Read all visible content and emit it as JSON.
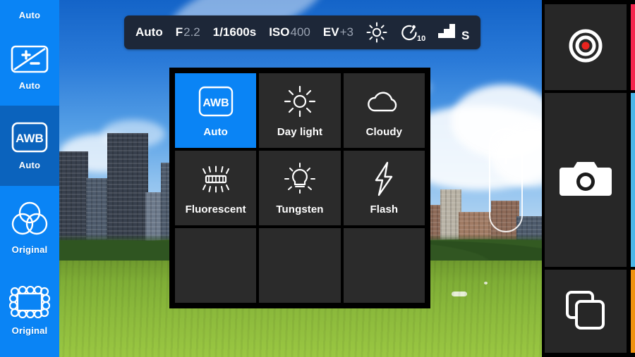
{
  "app": {
    "name": "camera-app",
    "screen": "white-balance-picker"
  },
  "sidebar": {
    "background_color": "#0a84f5",
    "active_color": "#0b63bd",
    "items": [
      {
        "id": "partial-top",
        "icon": "none",
        "label": "Auto",
        "active": false,
        "partial": true
      },
      {
        "id": "exposure-compensation",
        "icon": "plus-minus-icon",
        "label": "Auto",
        "active": false
      },
      {
        "id": "white-balance",
        "icon": "awb-icon",
        "label": "Auto",
        "active": true
      },
      {
        "id": "color-filter",
        "icon": "color-circles-icon",
        "label": "Original",
        "active": false
      },
      {
        "id": "frame",
        "icon": "scalloped-frame-icon",
        "label": "Original",
        "active": false
      }
    ]
  },
  "toolbar": {
    "background_color": "#1d2738",
    "items": [
      {
        "id": "mode",
        "name": "Auto",
        "value": "",
        "type": "text"
      },
      {
        "id": "aperture",
        "name": "F",
        "value": "2.2",
        "type": "text"
      },
      {
        "id": "shutter-speed",
        "name": "1/1600s",
        "value": "",
        "type": "text"
      },
      {
        "id": "iso",
        "name": "ISO",
        "value": "400",
        "type": "text"
      },
      {
        "id": "exposure-value",
        "name": "EV",
        "value": "+3",
        "type": "text"
      },
      {
        "id": "brightness",
        "name": "sun-icon",
        "value": "",
        "type": "icon"
      },
      {
        "id": "timer",
        "name": "timer-icon",
        "value": "10s",
        "type": "icon"
      },
      {
        "id": "bracketing",
        "name": "stairs-icon",
        "value": "S",
        "type": "icon"
      }
    ]
  },
  "white_balance_grid": {
    "panel_background": "#000000",
    "cell_background": "#2b2b2b",
    "selected_color": "#0a84f5",
    "columns": 3,
    "rows": 3,
    "cells": [
      {
        "id": "awb",
        "icon": "awb-icon",
        "label": "Auto",
        "selected": true,
        "empty": false
      },
      {
        "id": "daylight",
        "icon": "sun-icon",
        "label": "Day light",
        "selected": false,
        "empty": false
      },
      {
        "id": "cloudy",
        "icon": "cloud-icon",
        "label": "Cloudy",
        "selected": false,
        "empty": false
      },
      {
        "id": "fluorescent",
        "icon": "fluorescent-icon",
        "label": "Fluorescent",
        "selected": false,
        "empty": false
      },
      {
        "id": "tungsten",
        "icon": "bulb-icon",
        "label": "Tungsten",
        "selected": false,
        "empty": false
      },
      {
        "id": "flash",
        "icon": "lightning-icon",
        "label": "Flash",
        "selected": false,
        "empty": false
      },
      {
        "id": "empty-1",
        "icon": "none",
        "label": "",
        "selected": false,
        "empty": true
      },
      {
        "id": "empty-2",
        "icon": "none",
        "label": "",
        "selected": false,
        "empty": true
      },
      {
        "id": "empty-3",
        "icon": "none",
        "label": "",
        "selected": false,
        "empty": true
      }
    ]
  },
  "right_controls": {
    "background_color": "#000000",
    "button_background": "#272727",
    "buttons": [
      {
        "id": "record",
        "icon": "record-icon",
        "strip_color": "#f4274f"
      },
      {
        "id": "shutter",
        "icon": "camera-icon",
        "strip_color": "#4cb6e8"
      },
      {
        "id": "gallery",
        "icon": "burst-icon",
        "strip_color": "#f0920f"
      }
    ]
  },
  "viewfinder": {
    "reticle": {
      "id": "exposure-slider",
      "icon": "plus-icon"
    }
  }
}
